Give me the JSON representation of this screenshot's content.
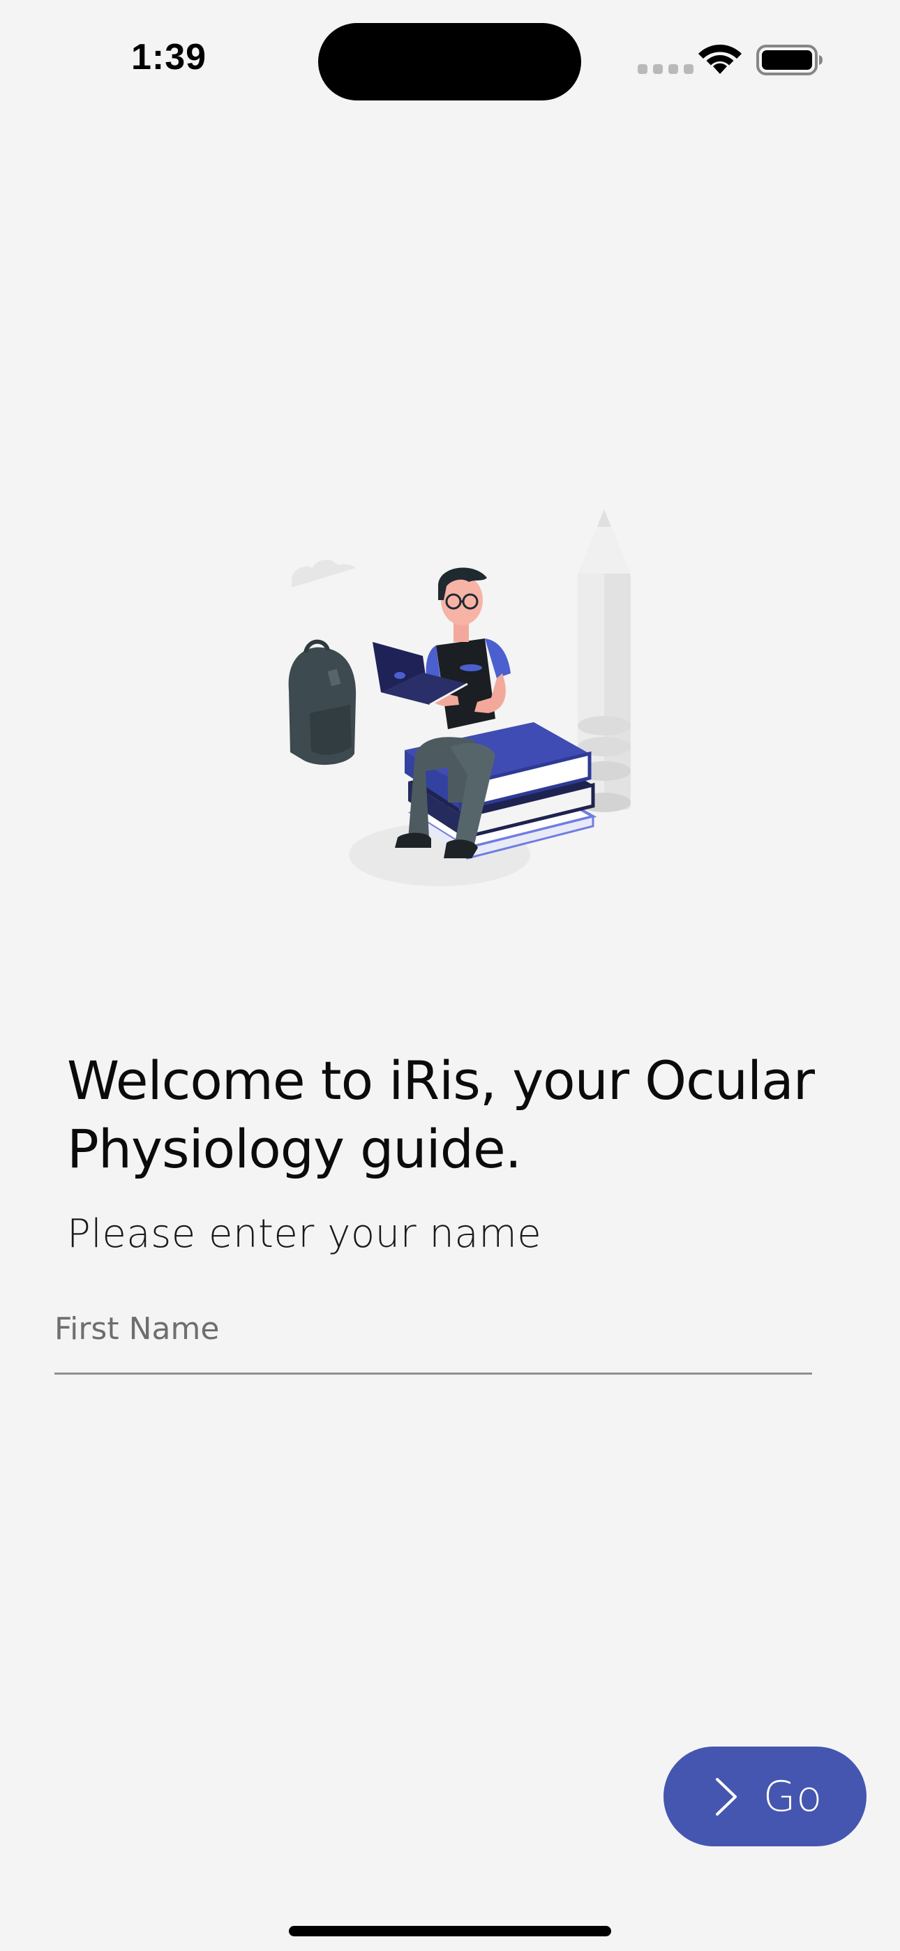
{
  "status_bar": {
    "time": "1:39",
    "icons": [
      "cellular-signal-icon",
      "wifi-icon",
      "battery-icon"
    ]
  },
  "illustration": {
    "icon": "student-on-books-illustration"
  },
  "welcome": {
    "title": "Welcome to iRis, your Ocular Physiology guide.",
    "prompt": "Please enter your name"
  },
  "form": {
    "first_name_value": "",
    "first_name_placeholder": "First Name"
  },
  "actions": {
    "go_label": "Go",
    "go_icon": "chevron-right-icon"
  },
  "colors": {
    "background": "#f4f4f4",
    "accent": "#4556b0",
    "text": "#0b0b0b"
  }
}
